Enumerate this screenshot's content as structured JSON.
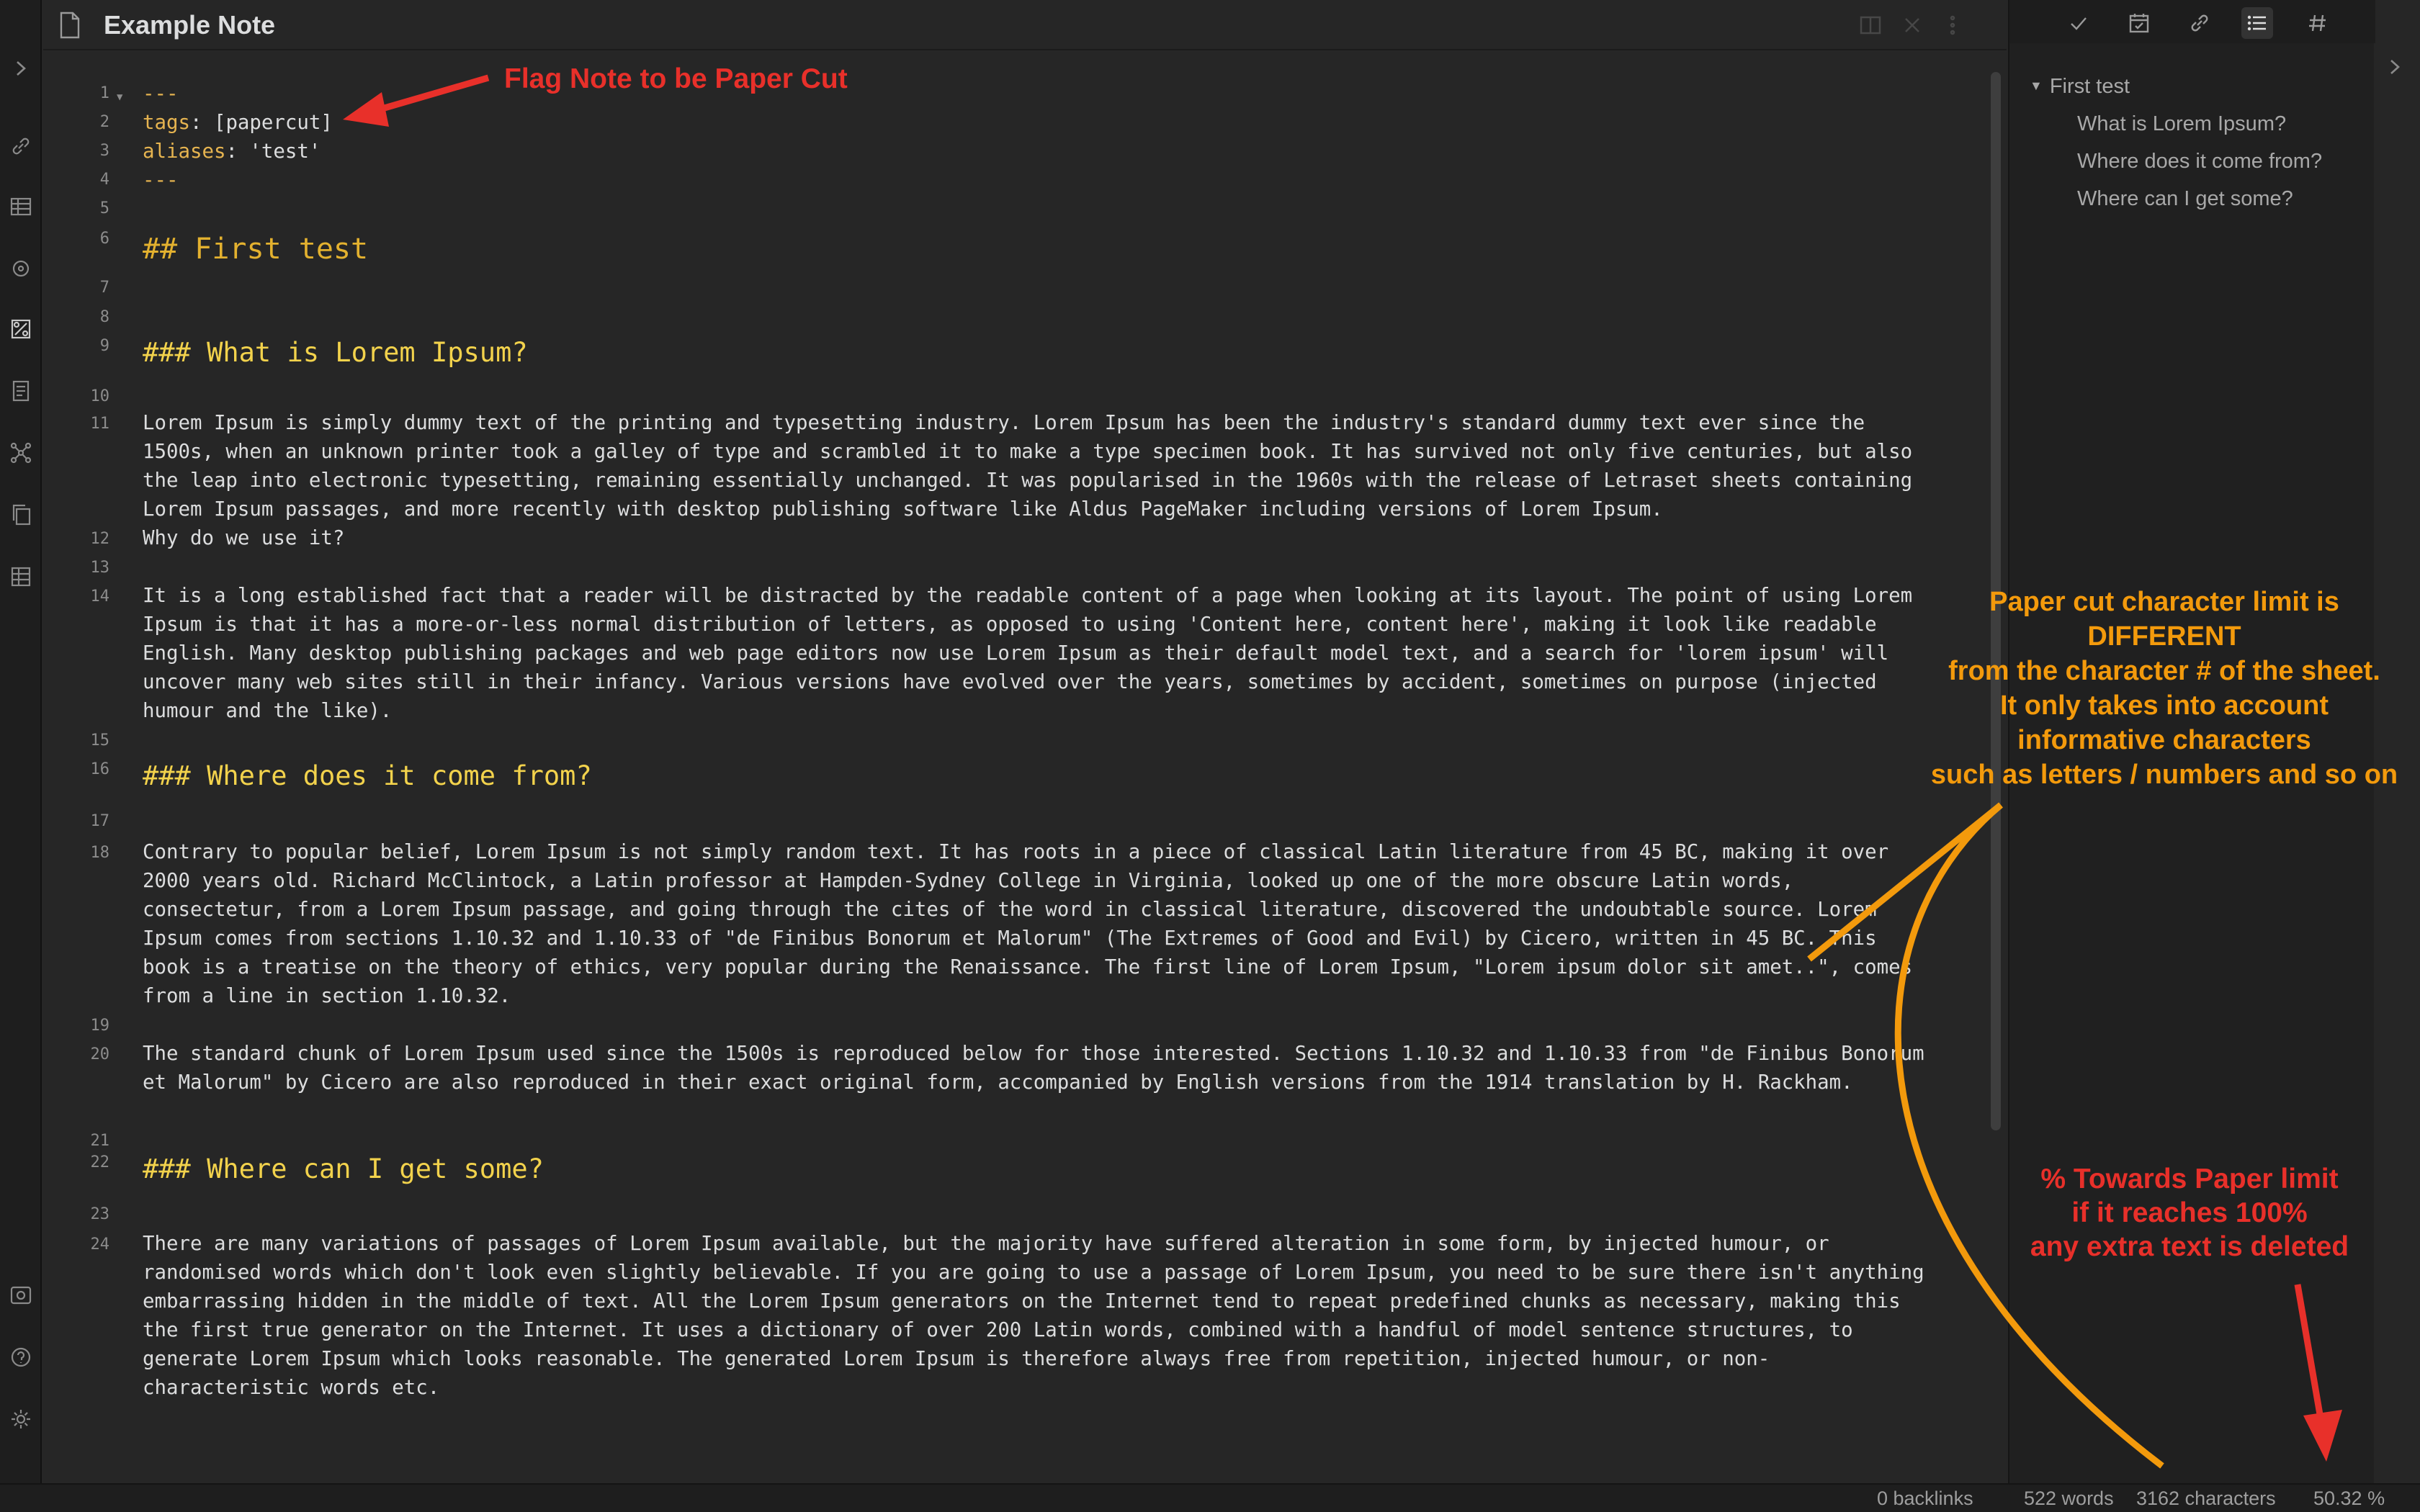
{
  "app": {
    "note_title": "Example Note"
  },
  "ribbon": {
    "icons": [
      "link-icon",
      "table-icon",
      "graph-local-icon",
      "paper-cut-icon",
      "template-icon",
      "graph-icon",
      "copy-icon",
      "database-icon",
      "vault-icon",
      "help-icon",
      "settings-icon"
    ]
  },
  "editor": {
    "lines": [
      {
        "n": "1",
        "text": "---"
      },
      {
        "n": "2",
        "key": "tags",
        "value": "[papercut]"
      },
      {
        "n": "3",
        "key": "aliases",
        "value": "'test'"
      },
      {
        "n": "4",
        "text": "---"
      },
      {
        "n": "5",
        "text": ""
      },
      {
        "n": "6",
        "text": "## First test"
      },
      {
        "n": "7",
        "text": ""
      },
      {
        "n": "8",
        "text": ""
      },
      {
        "n": "9",
        "text": "### What is Lorem Ipsum?"
      },
      {
        "n": "10",
        "text": ""
      },
      {
        "n": "11",
        "text": "Lorem Ipsum is simply dummy text of the printing and typesetting industry. Lorem Ipsum has been the industry's standard dummy text ever since the 1500s, when an unknown printer took a galley of type and scrambled it to make a type specimen book. It has survived not only five centuries, but also the leap into electronic typesetting, remaining essentially unchanged. It was popularised in the 1960s with the release of Letraset sheets containing Lorem Ipsum passages, and more recently with desktop publishing software like Aldus PageMaker including versions of Lorem Ipsum."
      },
      {
        "n": "12",
        "text": "Why do we use it?"
      },
      {
        "n": "13",
        "text": ""
      },
      {
        "n": "14",
        "text": "It is a long established fact that a reader will be distracted by the readable content of a page when looking at its layout. The point of using Lorem Ipsum is that it has a more-or-less normal distribution of letters, as opposed to using 'Content here, content here', making it look like readable English. Many desktop publishing packages and web page editors now use Lorem Ipsum as their default model text, and a search for 'lorem ipsum' will uncover many web sites still in their infancy. Various versions have evolved over the years, sometimes by accident, sometimes on purpose (injected humour and the like)."
      },
      {
        "n": "15",
        "text": ""
      },
      {
        "n": "16",
        "text": "### Where does it come from?"
      },
      {
        "n": "17",
        "text": ""
      },
      {
        "n": "18",
        "text": "Contrary to popular belief, Lorem Ipsum is not simply random text. It has roots in a piece of classical Latin literature from 45 BC, making it over 2000 years old. Richard McClintock, a Latin professor at Hampden-Sydney College in Virginia, looked up one of the more obscure Latin words, consectetur, from a Lorem Ipsum passage, and going through the cites of the word in classical literature, discovered the undoubtable source. Lorem Ipsum comes from sections 1.10.32 and 1.10.33 of \"de Finibus Bonorum et Malorum\" (The Extremes of Good and Evil) by Cicero, written in 45 BC. This book is a treatise on the theory of ethics, very popular during the Renaissance. The first line of Lorem Ipsum, \"Lorem ipsum dolor sit amet..\", comes from a line in section 1.10.32."
      },
      {
        "n": "19",
        "text": ""
      },
      {
        "n": "20",
        "text": "The standard chunk of Lorem Ipsum used since the 1500s is reproduced below for those interested. Sections 1.10.32 and 1.10.33 from \"de Finibus Bonorum et Malorum\" by Cicero are also reproduced in their exact original form, accompanied by English versions from the 1914 translation by H. Rackham."
      },
      {
        "n": "21",
        "text": ""
      },
      {
        "n": "22",
        "text": "### Where can I get some?"
      },
      {
        "n": "23",
        "text": ""
      },
      {
        "n": "24",
        "text": "There are many variations of passages of Lorem Ipsum available, but the majority have suffered alteration in some form, by injected humour, or randomised words which don't look even slightly believable. If you are going to use a passage of Lorem Ipsum, you need to be sure there isn't anything embarrassing hidden in the middle of text. All the Lorem Ipsum generators on the Internet tend to repeat predefined chunks as necessary, making this the first true generator on the Internet. It uses a dictionary of over 200 Latin words, combined with a handful of model sentence structures, to generate Lorem Ipsum which looks reasonable. The generated Lorem Ipsum is therefore always free from repetition, injected humour, or non-characteristic words etc."
      }
    ]
  },
  "right_panel": {
    "tabs": [
      "check-icon",
      "calendar-icon",
      "link-icon",
      "outline-icon",
      "tag-icon"
    ],
    "active_tab": "outline-icon",
    "outline": {
      "heading": "First test",
      "items": [
        "What is Lorem Ipsum?",
        "Where does it come from?",
        "Where can I get some?"
      ]
    }
  },
  "status_bar": {
    "backlinks": "0 backlinks",
    "words": "522 words",
    "characters": "3162 characters",
    "percent": "50.32 %"
  },
  "annotations": {
    "flag_note": "Flag Note to be Paper Cut",
    "char_limit": [
      "Paper cut character limit is",
      "DIFFERENT",
      "from the character # of the sheet.",
      "It only takes into account",
      "informative characters",
      "such as letters / numbers and so on"
    ],
    "percent_limit": [
      "% Towards Paper limit",
      "if it reaches 100%",
      "any extra text is deleted"
    ],
    "colors": {
      "red": "#e8302a",
      "orange": "#f39a0c"
    }
  }
}
